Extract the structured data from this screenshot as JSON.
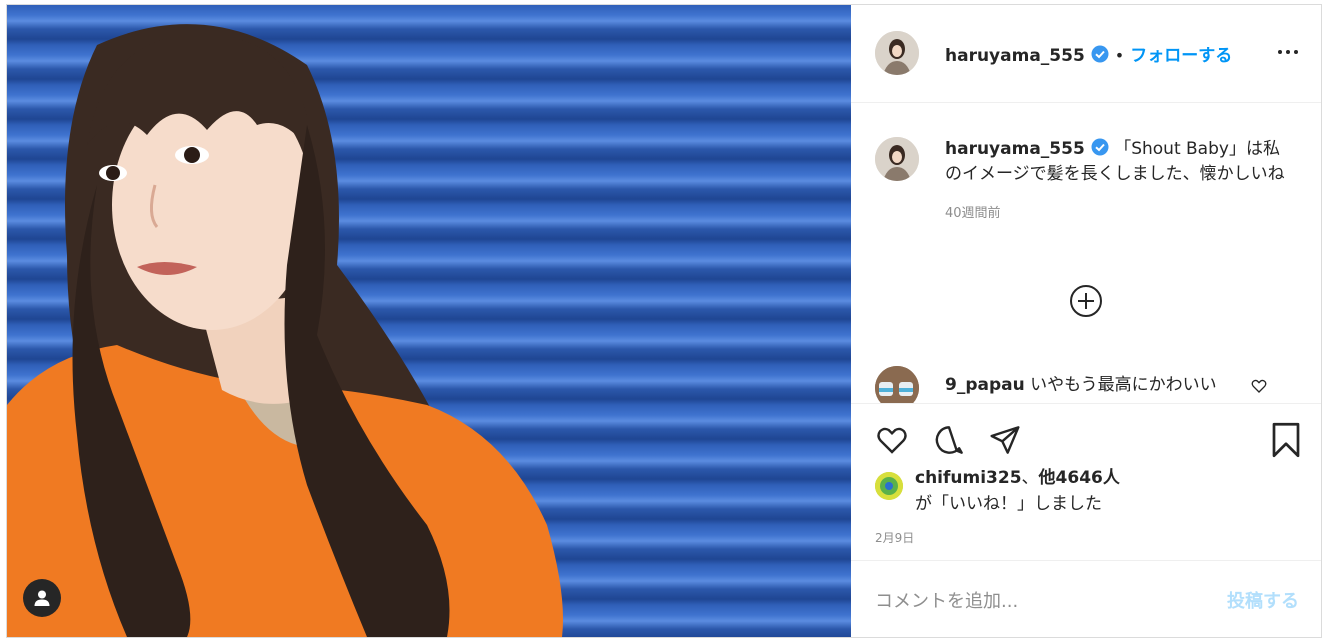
{
  "header": {
    "username": "haruyama_555",
    "separator": "•",
    "follow_label": "フォローする",
    "more_icon": "more-horizontal-icon"
  },
  "caption": {
    "username": "haruyama_555",
    "text": "「Shout Baby」は私のイメージで髪を長くしました、懐かしいね",
    "time": "40週間前"
  },
  "comments": [
    {
      "username": "9_papau",
      "text": "いやもう最高にかわいい"
    }
  ],
  "actions": {
    "like_icon": "heart-icon",
    "comment_icon": "comment-icon",
    "share_icon": "send-icon",
    "save_icon": "bookmark-icon"
  },
  "likes": {
    "user": "chifumi325",
    "sep": "、",
    "others": "他4646人",
    "suffix": "が「いいね！」しました"
  },
  "post_date": "2月9日",
  "comment_box": {
    "placeholder": "コメントを追加...",
    "post_label": "投稿する"
  },
  "colors": {
    "accent": "#0095f6",
    "post_disabled": "#b2dffc",
    "verified": "#3897f0"
  }
}
